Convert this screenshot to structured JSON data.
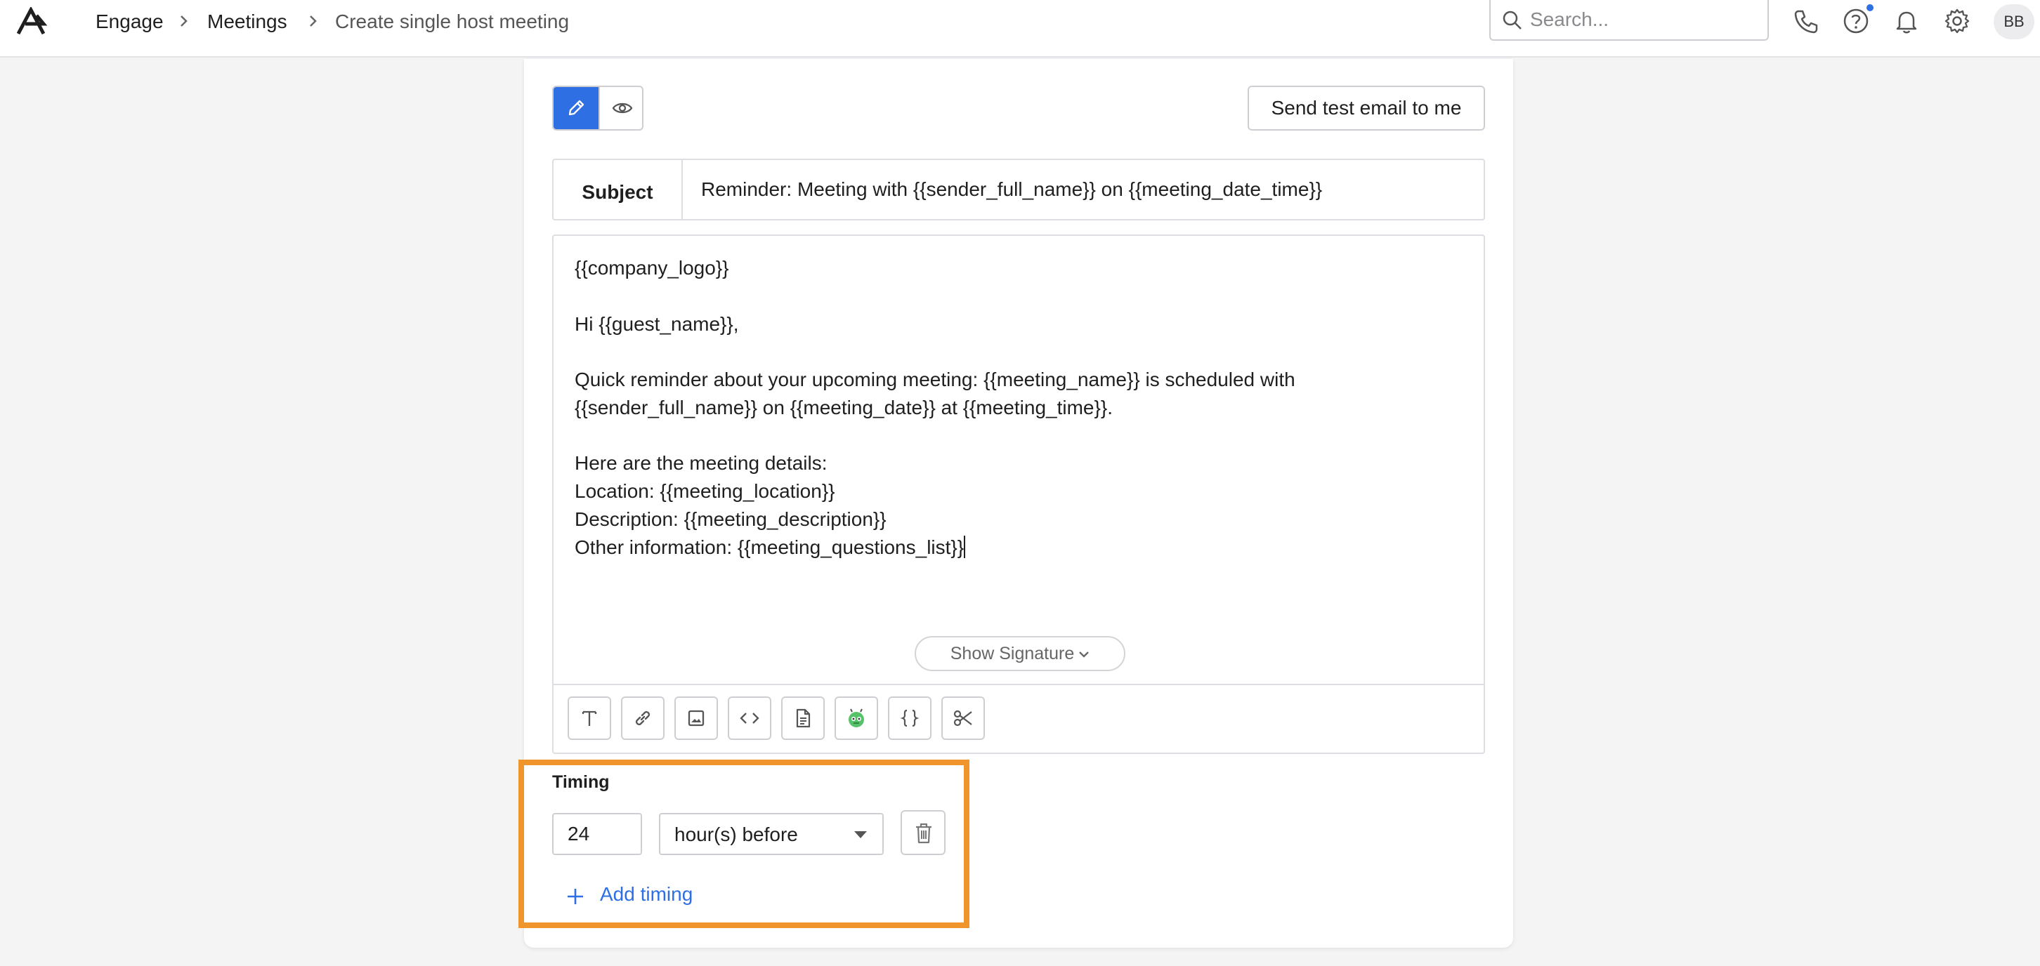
{
  "header": {
    "breadcrumbs": [
      "Engage",
      "Meetings",
      "Create single host meeting"
    ],
    "search_placeholder": "Search...",
    "user_initials": "BB",
    "icons": [
      "logo-icon",
      "phone-icon",
      "help-icon",
      "bell-icon",
      "settings-icon"
    ],
    "accent_color": "#2f6fe4"
  },
  "email": {
    "mode_buttons": [
      "pencil-icon",
      "eye-icon"
    ],
    "active_mode": "edit",
    "send_test_label": "Send test email to me",
    "subject_label": "Subject",
    "subject_value": "Reminder: Meeting with {{sender_full_name}} on {{meeting_date_time}}",
    "body_lines": [
      "{{company_logo}}",
      "Hi {{guest_name}},",
      "Quick reminder about your upcoming meeting: {{meeting_name}} is scheduled with",
      "{{sender_full_name}} on {{meeting_date}} at {{meeting_time}}.",
      "Here are the meeting details:",
      "Location: {{meeting_location}}",
      "Description: {{meeting_description}}",
      "Other information: {{meeting_questions_list}}"
    ],
    "show_signature_label": "Show Signature",
    "toolbar_icons": [
      "text-icon",
      "link-icon",
      "image-icon",
      "code-icon",
      "document-icon",
      "ai-assistant-icon",
      "variables-icon",
      "scissors-icon"
    ]
  },
  "timing": {
    "label": "Timing",
    "value": "24",
    "unit_selected": "hour(s) before",
    "add_label": "Add timing",
    "highlight_color": "#f0952c"
  }
}
